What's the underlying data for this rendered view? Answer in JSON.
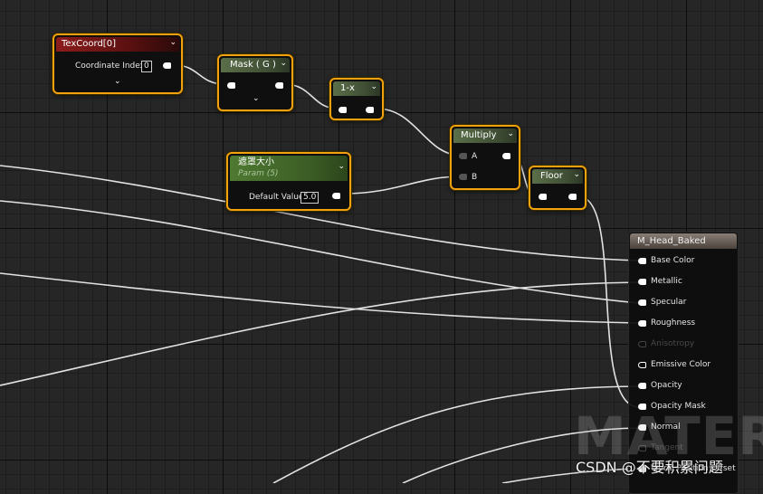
{
  "nodes": {
    "texcoord": {
      "title": "TexCoord[0]",
      "field_label": "Coordinate Index",
      "field_value": "0"
    },
    "mask": {
      "title": "Mask ( G )"
    },
    "one_minus": {
      "title": "1-x"
    },
    "multiply": {
      "title": "Multiply",
      "input_a": "A",
      "input_b": "B"
    },
    "floor": {
      "title": "Floor"
    },
    "param": {
      "title": "遮罩大小",
      "subtitle": "Param (5)",
      "field_label": "Default Value",
      "field_value": "5.0"
    },
    "material": {
      "title": "M_Head_Baked",
      "inputs": [
        "Base Color",
        "Metallic",
        "Specular",
        "Roughness",
        "Anisotropy",
        "Emissive Color",
        "Opacity",
        "Opacity Mask",
        "Normal",
        "Tangent",
        "World Position Offset"
      ]
    }
  },
  "watermark": "MATERIA",
  "credit": "CSDN @不要积累问题",
  "colors": {
    "selected_border": "#f2a20c",
    "texcoord_header": "#8c1c1c",
    "math_header": "#5b6f4a",
    "wire": "#e0e0e0"
  }
}
